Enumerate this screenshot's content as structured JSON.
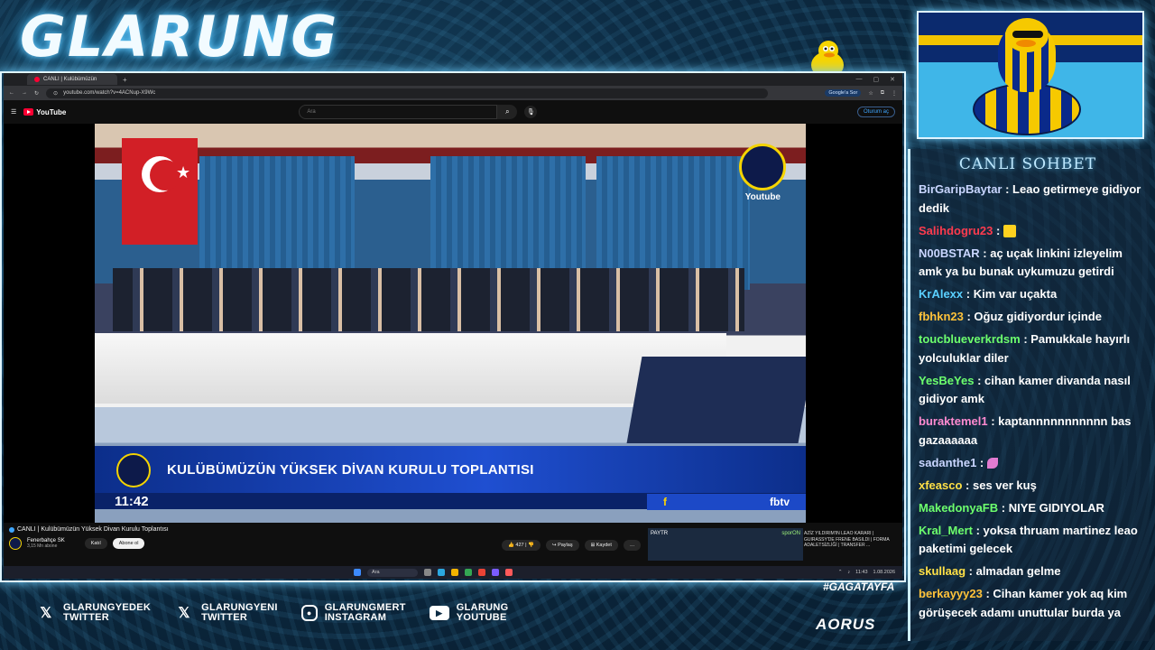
{
  "brand": {
    "title": "GLARUNG"
  },
  "browser": {
    "tab_title": "CANLI | Kulübümüzün",
    "url": "youtube.com/watch?v=4ACNup-X9Wc",
    "google_button": "Google'a Sor"
  },
  "youtube": {
    "logo_text": "YouTube",
    "search_placeholder": "Ara",
    "signin_label": "Oturum aç",
    "video_title": "CANLI | Kulübümüzün Yüksek Divan Kurulu Toplantısı",
    "channel_name": "Fenerbahçe SK",
    "channel_subs": "3,15 Mn abone",
    "join_label": "Katıl",
    "subscribe_label": "Abone ol",
    "like_count": "427",
    "share_label": "Paylaş",
    "save_label": "Kaydet",
    "more_label": "…"
  },
  "video_overlay": {
    "watermark": "Youtube",
    "banner_text": "KULÜBÜMÜZÜN YÜKSEK DİVAN KURULU TOPLANTISI",
    "time": "11:42",
    "fbtv": "fbtv"
  },
  "recommendation": {
    "sponsor": "PAYTR",
    "label": "sporON",
    "title": "AZİZ YILDIRIM'IN LEAO KARARI | GUIRASSY'DE FRENE BASILDI | FORMA ADALETSİZLİĞİ | TRANSFER ..."
  },
  "taskbar": {
    "search": "Ara",
    "clock": "11:43",
    "date": "1.08.2026"
  },
  "chat": {
    "title": "CANLI SOHBET",
    "messages": [
      {
        "user": "BirGaripBaytar",
        "color": "#c9d6ff",
        "text": "Leao getirmeye gidiyor dedik"
      },
      {
        "user": "Salihdogru23",
        "color": "#ff3b4e",
        "text": ""
      },
      {
        "user": "N00BSTAR",
        "color": "#c9d6ff",
        "text": "aç uçak linkini izleyelim amk ya bu bunak uykumuzu getirdi"
      },
      {
        "user": "KrAlexx",
        "color": "#5ad0ff",
        "text": "Kim var uçakta"
      },
      {
        "user": "fbhkn23",
        "color": "#ffc23a",
        "text": "Oğuz gidiyordur içinde"
      },
      {
        "user": "toucblueverkrdsm",
        "color": "#6dff6d",
        "text": "Pamukkale hayırlı yolculuklar diler"
      },
      {
        "user": "YesBeYes",
        "color": "#6dff6d",
        "text": "cihan kamer divanda nasıl gidiyor amk"
      },
      {
        "user": "buraktemel1",
        "color": "#ff8ad0",
        "text": "kaptannnnnnnnnnn bas gazaaaaaa"
      },
      {
        "user": "sadanthe1",
        "color": "#c9d6ff",
        "text": ""
      },
      {
        "user": "xfeasco",
        "color": "#ffe046",
        "text": "ses ver kuş"
      },
      {
        "user": "MakedonyaFB",
        "color": "#6dff6d",
        "text": "NIYE GIDIYOLAR"
      },
      {
        "user": "Kral_Mert",
        "color": "#6dff6d",
        "text": "yoksa thruam martinez leao paketimi gelecek"
      },
      {
        "user": "skullaag",
        "color": "#ffe046",
        "text": "almadan gelme"
      },
      {
        "user": "berkayyy23",
        "color": "#ffc23a",
        "text": "Cihan kamer yok aq kim görüşecek adamı unuttular burda ya"
      }
    ]
  },
  "footer": {
    "hashtag": "#GAGATAYFA",
    "socials": [
      {
        "line1": "GLARUNGYEDEK",
        "line2": "TWITTER"
      },
      {
        "line1": "GLARUNGYENI",
        "line2": "TWITTER"
      },
      {
        "line1": "GLARUNGMERT",
        "line2": "INSTAGRAM"
      },
      {
        "line1": "GLARUNG",
        "line2": "YOUTUBE"
      }
    ],
    "sponsor": "AORUS"
  },
  "colors": {
    "accent": "#6fd0ff",
    "fb_yellow": "#f5d400",
    "fb_navy": "#0d1a4a",
    "yt_red": "#ff0033"
  }
}
